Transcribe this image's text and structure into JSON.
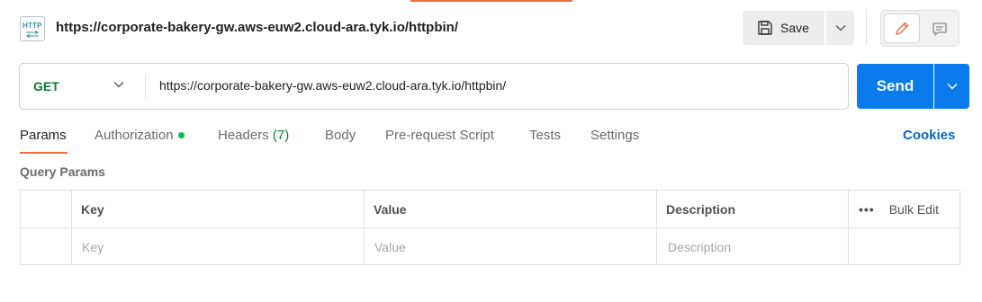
{
  "header": {
    "icon_text": "HTTP",
    "title": "https://corporate-bakery-gw.aws-euw2.cloud-ara.tyk.io/httpbin/",
    "save_label": "Save"
  },
  "request": {
    "method": "GET",
    "url": "https://corporate-bakery-gw.aws-euw2.cloud-ara.tyk.io/httpbin/",
    "send_label": "Send"
  },
  "tabs": {
    "params": "Params",
    "authorization": "Authorization",
    "headers": "Headers",
    "headers_count": "(7)",
    "body": "Body",
    "prerequest": "Pre-request Script",
    "tests": "Tests",
    "settings": "Settings",
    "cookies": "Cookies"
  },
  "query_params": {
    "title": "Query Params",
    "columns": {
      "key": "Key",
      "value": "Value",
      "description": "Description"
    },
    "bulk_edit": "Bulk Edit",
    "more": "•••",
    "placeholders": {
      "key": "Key",
      "value": "Value",
      "description": "Description"
    }
  },
  "colors": {
    "accent": "#f26b3a",
    "send": "#097bed",
    "method_get": "#0b7c2f",
    "auth_dot": "#0cbb52",
    "link": "#0a66c9"
  }
}
